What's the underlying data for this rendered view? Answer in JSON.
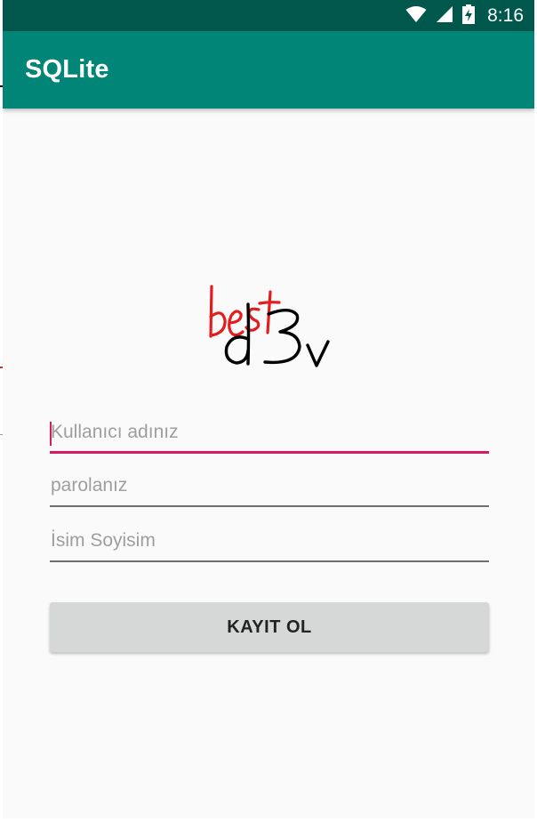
{
  "status_bar": {
    "time": "8:16",
    "icons": [
      "wifi-icon",
      "cellular-signal-icon",
      "battery-charging-icon"
    ],
    "color": "#00574b"
  },
  "app_bar": {
    "title": "SQLite",
    "color": "#008577"
  },
  "logo": {
    "word_top": "best",
    "word_bottom": "d3v"
  },
  "form": {
    "username": {
      "value": "",
      "placeholder": "Kullanıcı adınız",
      "focused": true
    },
    "password": {
      "value": "",
      "placeholder": "parolanız"
    },
    "full_name": {
      "value": "",
      "placeholder": "İsim Soyisim"
    },
    "register_button": "KAYIT OL"
  },
  "colors": {
    "accent": "#d81b60",
    "background": "#fafafa",
    "button": "#d6d7d7"
  }
}
